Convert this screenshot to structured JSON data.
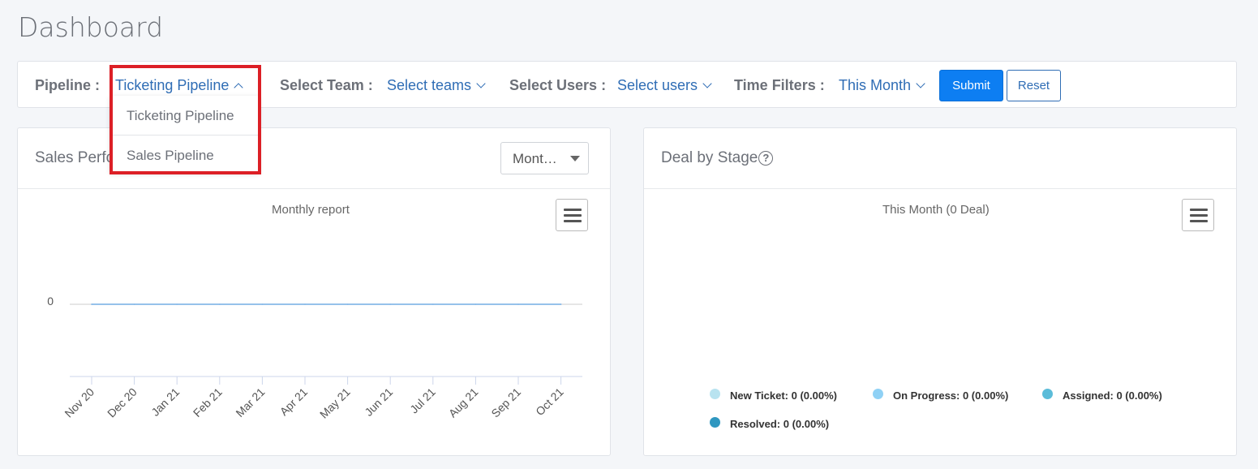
{
  "page": {
    "title": "Dashboard"
  },
  "filters": {
    "pipeline_label": "Pipeline :",
    "pipeline_value": "Ticketing Pipeline",
    "team_label": "Select Team :",
    "team_value": "Select teams",
    "users_label": "Select Users :",
    "users_value": "Select users",
    "time_label": "Time Filters :",
    "time_value": "This Month",
    "submit_label": "Submit",
    "reset_label": "Reset"
  },
  "pipeline_dropdown": {
    "options": [
      "Ticketing Pipeline",
      "Sales Pipeline"
    ]
  },
  "sales_card": {
    "title": "Sales Perfo",
    "period_select": "Mont…",
    "chart_title": "Monthly report"
  },
  "deal_card": {
    "title": "Deal by Stage",
    "help_glyph": "?",
    "chart_title": "This Month (0 Deal)"
  },
  "chart_data": [
    {
      "type": "line",
      "title": "Monthly report",
      "categories": [
        "Nov 20",
        "Dec 20",
        "Jan 21",
        "Feb 21",
        "Mar 21",
        "Apr 21",
        "May 21",
        "Jun 21",
        "Jul 21",
        "Aug 21",
        "Sep 21",
        "Oct 21"
      ],
      "series": [
        {
          "values": [
            0,
            0,
            0,
            0,
            0,
            0,
            0,
            0,
            0,
            0,
            0,
            0
          ],
          "color": "#7cb5ec"
        }
      ],
      "yticks": [
        "0"
      ],
      "grid": true
    },
    {
      "type": "pie",
      "title": "This Month (0 Deal)",
      "series": [
        {
          "name": "New Ticket",
          "label": "New Ticket: 0 (0.00%)",
          "value": 0,
          "color": "#b8e3f0"
        },
        {
          "name": "On Progress",
          "label": "On Progress: 0 (0.00%)",
          "value": 0,
          "color": "#8fd1f5"
        },
        {
          "name": "Assigned",
          "label": "Assigned: 0 (0.00%)",
          "value": 0,
          "color": "#5bbcd9"
        },
        {
          "name": "Resolved",
          "label": "Resolved: 0 (0.00%)",
          "value": 0,
          "color": "#2f97c0"
        }
      ],
      "legend": "bottom"
    }
  ],
  "colors": {
    "accent": "#0d7ef2",
    "link": "#2f6db5",
    "highlight": "#dc1f26"
  },
  "icons": {
    "menu": "hamburger-menu-icon",
    "help": "question-circle-icon",
    "chevron": "chevron-down-icon"
  }
}
